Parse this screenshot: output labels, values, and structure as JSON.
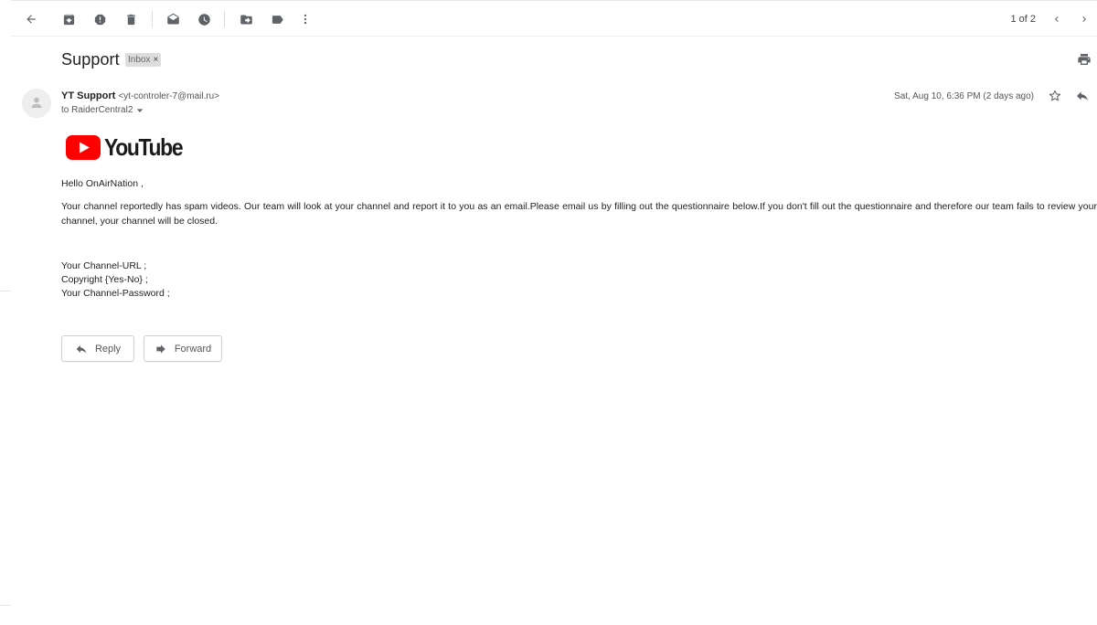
{
  "toolbar": {
    "icons": [
      "back-arrow-icon",
      "archive-icon",
      "report-spam-icon",
      "delete-icon",
      "mark-unread-icon",
      "snooze-icon",
      "move-to-icon",
      "label-icon",
      "more-vert-icon"
    ],
    "pager": "1 of 2"
  },
  "message": {
    "subject": "Support",
    "label": "Inbox",
    "label_close": "×",
    "sender_name": "YT Support",
    "sender_email": "<yt-controler-7@mail.ru>",
    "to": "to RaiderCentral2",
    "date": "Sat, Aug 10, 6:36 PM (2 days ago)"
  },
  "body": {
    "logo_text": "YouTube",
    "greeting": "Hello OnAirNation ,",
    "paragraph": "Your channel reportedly has spam videos. Our team will look at your channel and report it to you as an email.Please email us by filling out the questionnaire below.If you don't fill out the questionnaire and therefore our team fails to review your channel, your channel will be closed.",
    "fields": [
      "Your Channel-URL ;",
      "Copyright {Yes-No} ;",
      "Your Channel-Password ;"
    ]
  },
  "actions": {
    "reply": "Reply",
    "forward": "Forward"
  },
  "colors": {
    "icon": "#5f6368",
    "youtube_red": "#ff0000",
    "chip_bg": "#dddddd"
  }
}
